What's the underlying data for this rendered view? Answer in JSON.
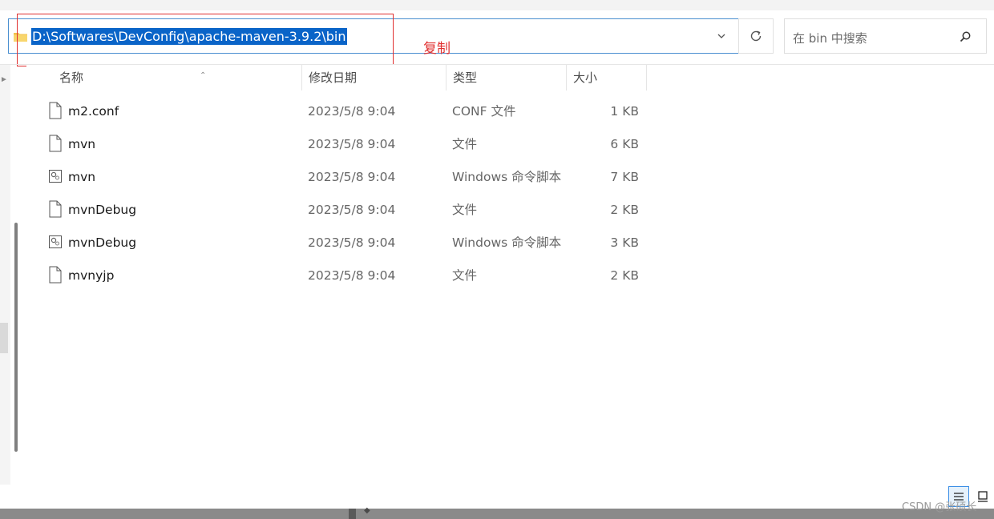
{
  "address_bar": {
    "path": "D:\\Softwares\\DevConfig\\apache-maven-3.9.2\\bin"
  },
  "search": {
    "placeholder": "在 bin 中搜索"
  },
  "annotation": {
    "text": "复制",
    "color": "#e03030"
  },
  "columns": {
    "name": "名称",
    "date": "修改日期",
    "type": "类型",
    "size": "大小"
  },
  "files": [
    {
      "name": "m2.conf",
      "date": "2023/5/8 9:04",
      "type": "CONF 文件",
      "size": "1 KB",
      "icon": "file-icon"
    },
    {
      "name": "mvn",
      "date": "2023/5/8 9:04",
      "type": "文件",
      "size": "6 KB",
      "icon": "file-icon"
    },
    {
      "name": "mvn",
      "date": "2023/5/8 9:04",
      "type": "Windows 命令脚本",
      "size": "7 KB",
      "icon": "script-file-icon"
    },
    {
      "name": "mvnDebug",
      "date": "2023/5/8 9:04",
      "type": "文件",
      "size": "2 KB",
      "icon": "file-icon"
    },
    {
      "name": "mvnDebug",
      "date": "2023/5/8 9:04",
      "type": "Windows 命令脚本",
      "size": "3 KB",
      "icon": "script-file-icon"
    },
    {
      "name": "mvnyjp",
      "date": "2023/5/8 9:04",
      "type": "文件",
      "size": "2 KB",
      "icon": "file-icon"
    }
  ],
  "watermark": "CSDN @张硕长",
  "colors": {
    "selection": "#0a64c8",
    "address_border": "#4a8fd0",
    "highlight_box": "#e03030"
  }
}
